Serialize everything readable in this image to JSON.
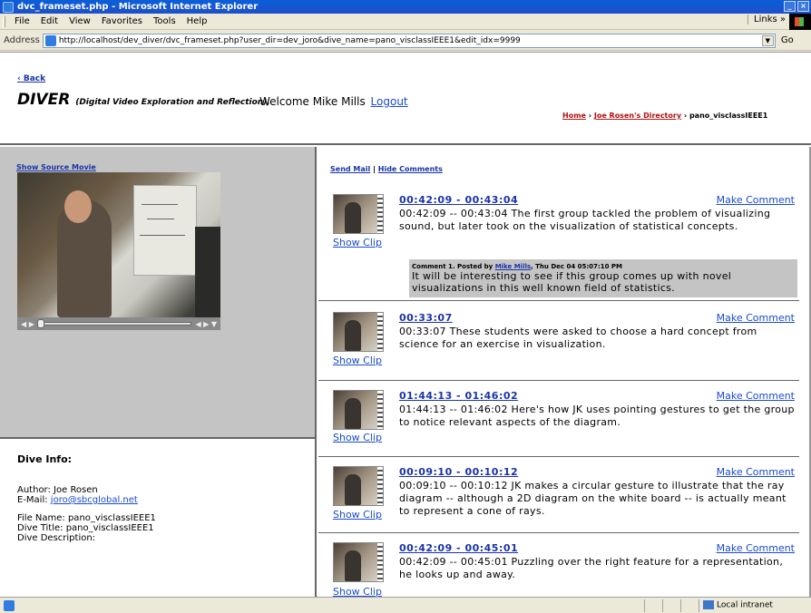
{
  "window": {
    "title": "dvc_frameset.php - Microsoft Internet Explorer",
    "buttons": [
      "_",
      "×"
    ]
  },
  "menu": {
    "items": [
      "File",
      "Edit",
      "View",
      "Favorites",
      "Tools",
      "Help"
    ],
    "links_label": "Links »"
  },
  "address": {
    "label": "Address",
    "url": "http://localhost/dev_diver/dvc_frameset.php?user_dir=dev_joro&dive_name=pano_visclassIEEE1&edit_idx=9999",
    "go_label": "Go"
  },
  "header": {
    "back_label": "‹ Back",
    "app_name": "DIVER",
    "app_subtitle": "(Digital Video Exploration and Reflection),",
    "welcome_text": "Welcome Mike Mills",
    "logout_label": "Logout",
    "breadcrumb": {
      "home": "Home",
      "directory": "Joe Rosen's Directory",
      "current": "pano_visclassIEEE1",
      "separator": "›"
    }
  },
  "left": {
    "show_source_label": "Show Source Movie",
    "video_controls": {
      "play": "◀ ▶",
      "right": "◀ ▶ ▼"
    }
  },
  "dive_info": {
    "heading": "Dive Info:",
    "author": "Author: Joe Rosen",
    "email_label": "E-Mail:",
    "email": "joro@sbcglobal.net",
    "file_name": "File Name: pano_visclassIEEE1",
    "dive_title": "Dive Title: pano_visclassIEEE1",
    "dive_description": "Dive Description:"
  },
  "right": {
    "send_mail_label": "Send Mail",
    "divider": "|",
    "hide_comments_label": "Hide Comments",
    "show_clip_label": "Show Clip",
    "make_comment_label": "Make Comment",
    "entries": [
      {
        "time": "00:42:09 - 00:43:04",
        "desc": "00:42:09 -- 00:43:04 The first group tackled the problem of visualizing sound, but later took on the visualization of statistical concepts.",
        "comment": {
          "prefix": "Comment 1. Posted by",
          "author": "Mike Mills",
          "date": ", Thu Dec 04 05:07:10 PM",
          "body": "It will be interesting to see if this group comes up with novel visualizations in this well known field of statistics."
        }
      },
      {
        "time": "00:33:07",
        "desc": "00:33:07 These students were asked to choose a hard concept from science for an exercise in visualization."
      },
      {
        "time": "01:44:13 - 01:46:02",
        "desc": "01:44:13 -- 01:46:02 Here's how JK uses pointing gestures to get the group to notice relevant aspects of the diagram."
      },
      {
        "time": "00:09:10 - 00:10:12",
        "desc": "00:09:10 -- 00:10:12 JK makes a circular gesture to illustrate that the ray diagram -- although a 2D diagram on the white board -- is actually meant to represent a cone of rays."
      },
      {
        "time": "00:42:09 - 00:45:01",
        "desc": "00:42:09 -- 00:45:01 Puzzling over the right feature for a representation, he looks up and away."
      }
    ]
  },
  "status": {
    "zone": "Local intranet"
  }
}
